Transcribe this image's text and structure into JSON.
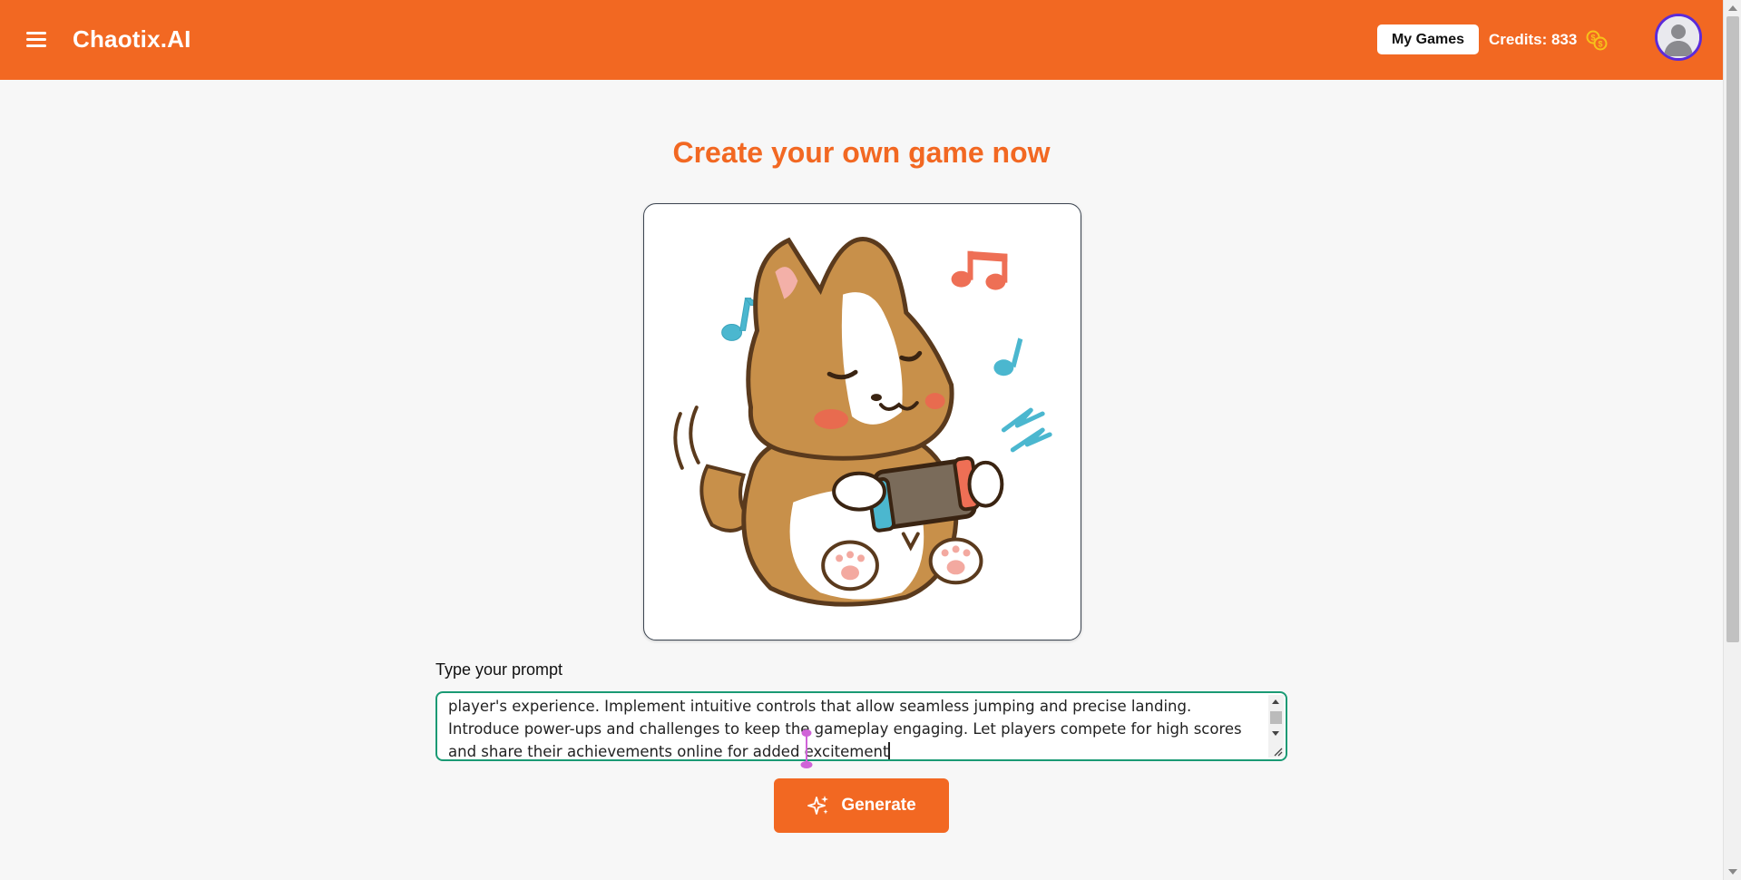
{
  "header": {
    "brand": "Chaotix.AI",
    "my_games_label": "My Games",
    "credits_text": "Credits: 833",
    "menu_icon": "hamburger-menu-icon",
    "coins_icon": "coins-icon",
    "avatar_icon": "user-avatar-icon"
  },
  "main": {
    "title": "Create your own game now",
    "image_alt": "Cartoon corgi playing a handheld game console with music notes",
    "prompt_label": "Type your prompt",
    "prompt_value": "player's experience. Implement intuitive controls that allow seamless jumping and precise landing. Introduce power-ups and challenges to keep the gameplay engaging. Let players compete for high scores and share their achievements online for added excitement",
    "generate_label": "Generate",
    "generate_icon": "sparkle-icon"
  },
  "colors": {
    "brand_orange": "#f26822",
    "input_border": "#1a9a74",
    "avatar_ring": "#5b2bd9"
  }
}
